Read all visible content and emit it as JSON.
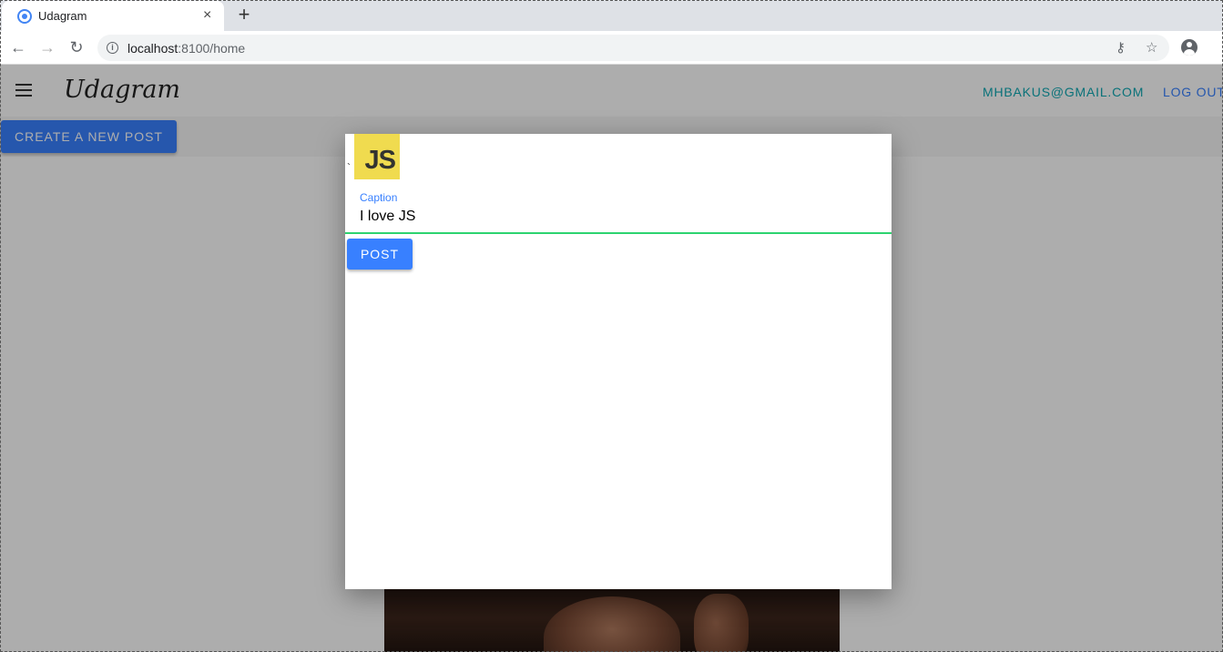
{
  "browser": {
    "tab_title": "Udagram",
    "tab_close": "×",
    "new_tab": "+",
    "url_host": "localhost",
    "url_path": ":8100/home",
    "back_glyph": "←",
    "forward_glyph": "→",
    "reload_glyph": "↻",
    "info_glyph": "i",
    "key_glyph": "⚷",
    "star_glyph": "☆"
  },
  "header": {
    "brand": "Udagram",
    "user_email": "MHBAKUS@GMAIL.COM",
    "logout_label": "LOG OUT"
  },
  "toolbar": {
    "create_post_label": "CREATE A NEW POST"
  },
  "modal": {
    "stray_char": "`",
    "preview_text": "JS",
    "caption_label": "Caption",
    "caption_value": "I love JS",
    "post_label": "POST"
  },
  "colors": {
    "primary": "#3880ff",
    "success": "#2dd36f",
    "email": "#0fa8b3",
    "js_yellow": "#f0db4f"
  }
}
